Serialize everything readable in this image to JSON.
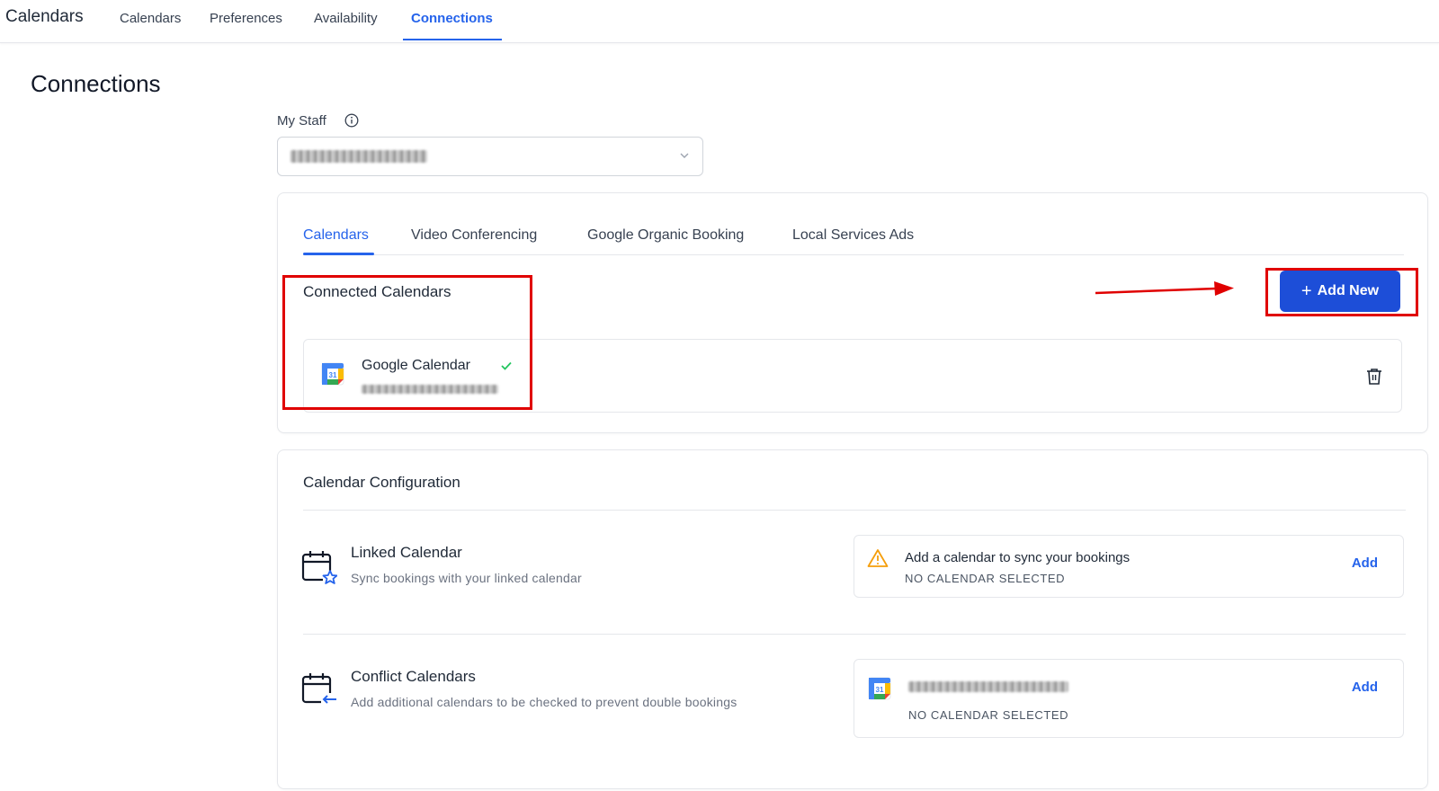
{
  "topnav": {
    "app_title": "Calendars",
    "items": [
      {
        "label": "Calendars",
        "active": false
      },
      {
        "label": "Preferences",
        "active": false
      },
      {
        "label": "Availability",
        "active": false
      },
      {
        "label": "Connections",
        "active": true
      }
    ]
  },
  "page": {
    "title": "Connections"
  },
  "staff": {
    "label": "My Staff"
  },
  "tabs": [
    {
      "label": "Calendars",
      "active": true
    },
    {
      "label": "Video Conferencing",
      "active": false
    },
    {
      "label": "Google Organic Booking",
      "active": false
    },
    {
      "label": "Local Services Ads",
      "active": false
    }
  ],
  "connected": {
    "title": "Connected Calendars",
    "add_new_label": "Add New",
    "items": [
      {
        "name": "Google Calendar",
        "status": "connected"
      }
    ]
  },
  "config": {
    "title": "Calendar Configuration",
    "linked": {
      "title": "Linked Calendar",
      "subtitle": "Sync bookings with your linked calendar",
      "status_title": "Add a calendar to sync your bookings",
      "status_sub": "NO CALENDAR SELECTED",
      "add_label": "Add"
    },
    "conflict": {
      "title": "Conflict Calendars",
      "subtitle": "Add additional calendars to be checked to prevent double bookings",
      "status_sub": "NO CALENDAR SELECTED",
      "add_label": "Add"
    }
  },
  "icons": {
    "info": "info-icon",
    "chevron": "chevron-down-icon",
    "calendar": "google-calendar-icon",
    "check": "check-icon",
    "trash": "trash-icon",
    "warning": "warning-icon",
    "calendar_star": "calendar-star-icon",
    "calendar_arrow": "calendar-arrow-icon"
  },
  "colors": {
    "accent": "#2563eb",
    "button": "#1d4ed8",
    "warning": "#f59e0b",
    "success": "#22c55e",
    "annotation": "#e00000"
  }
}
